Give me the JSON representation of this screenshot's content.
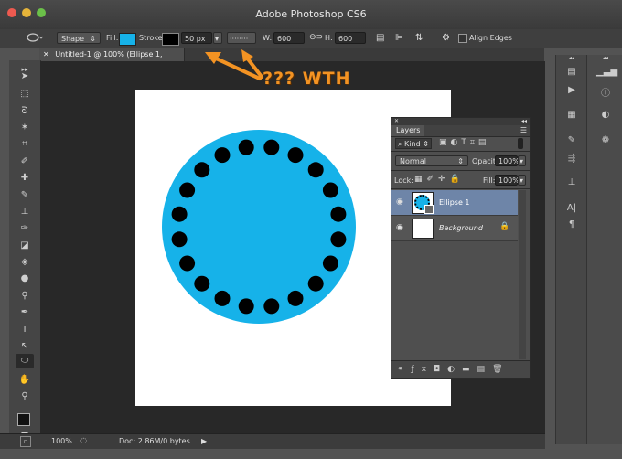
{
  "app": {
    "title": "Adobe Photoshop CS6"
  },
  "options_bar": {
    "mode": "Shape",
    "fill_label": "Fill:",
    "stroke_label": "Stroke:",
    "stroke_width": "50 px",
    "w_label": "W:",
    "w_value": "600 px",
    "h_label": "H:",
    "h_value": "600 px",
    "align_edges": "Align Edges",
    "fill_color": "#16b2e9",
    "stroke_color": "#000000"
  },
  "document": {
    "tab_title": "Untitled-1 @ 100% (Ellipse 1, RGB/8) *"
  },
  "annotation": {
    "text": "??? WTH",
    "color": "#f39323"
  },
  "layers_panel": {
    "title": "Layers",
    "filter": "Kind",
    "blend_mode": "Normal",
    "opacity_label": "Opacity:",
    "opacity_value": "100%",
    "lock_label": "Lock:",
    "fill_label": "Fill:",
    "fill_value": "100%",
    "layers": [
      {
        "name": "Ellipse 1",
        "selected": true
      },
      {
        "name": "Background",
        "selected": false
      }
    ]
  },
  "status_bar": {
    "zoom": "100%",
    "doc_info": "Doc: 2.86M/0 bytes"
  },
  "ellipse": {
    "fill": "#16b2e9",
    "dot_color": "#000000",
    "dot_count": 20
  }
}
